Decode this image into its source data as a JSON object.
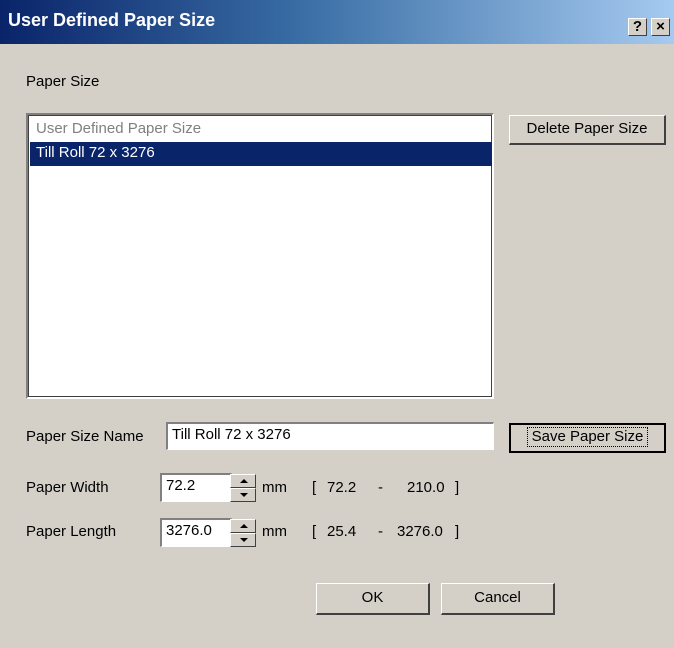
{
  "window": {
    "title": "User Defined Paper Size",
    "help_label": "?",
    "close_label": "×"
  },
  "paper_size_group_label": "Paper Size",
  "list": {
    "items": [
      {
        "label": "User Defined Paper Size",
        "selected": false
      },
      {
        "label": "Till Roll 72 x 3276",
        "selected": true
      }
    ]
  },
  "buttons": {
    "delete": "Delete Paper Size",
    "save": "Save Paper Size",
    "ok": "OK",
    "cancel": "Cancel"
  },
  "name_field": {
    "label": "Paper Size Name",
    "value": "Till Roll 72 x 3276"
  },
  "width": {
    "label": "Paper Width",
    "value": "72.2",
    "unit": "mm",
    "range_open": "[",
    "range_min": "72.2",
    "range_sep": "-",
    "range_max": "210.0",
    "range_close": "]"
  },
  "length": {
    "label": "Paper Length",
    "value": "3276.0",
    "unit": "mm",
    "range_open": "[",
    "range_min": "25.4",
    "range_sep": "-",
    "range_max": "3276.0",
    "range_close": "]"
  },
  "colors": {
    "title_gradient_start": "#0a246a",
    "title_gradient_end": "#a6caf0",
    "selection": "#0a246a",
    "dialog_bg": "#d4d0c8"
  }
}
